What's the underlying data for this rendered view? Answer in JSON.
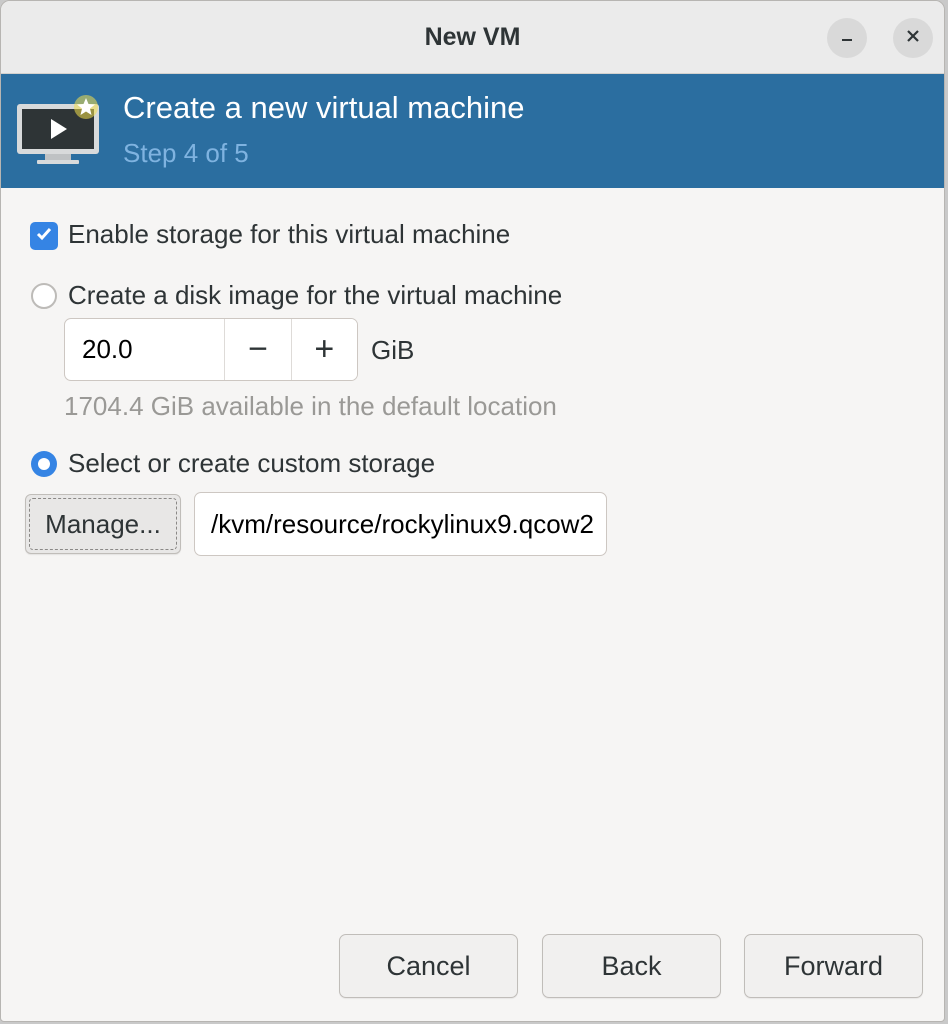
{
  "window": {
    "title": "New VM",
    "minimize_icon": "minimize-icon",
    "close_icon": "close-icon"
  },
  "banner": {
    "icon": "virtual-machine-icon",
    "heading": "Create a new virtual machine",
    "step": "Step 4 of 5",
    "background_color": "#2b6ea0"
  },
  "storage": {
    "enable_label": "Enable storage for this virtual machine",
    "enable_checked": true,
    "create_disk_label": "Create a disk image for the virtual machine",
    "create_disk_selected": false,
    "disk_size_value": "20.0",
    "decrement_label": "−",
    "increment_label": "+",
    "disk_size_unit": "GiB",
    "available_hint": "1704.4 GiB available in the default location",
    "custom_storage_label": "Select or create custom storage",
    "custom_storage_selected": true,
    "manage_label": "Manage...",
    "custom_path_value": "/kvm/resource/rockylinux9.qcow2"
  },
  "footer": {
    "cancel_label": "Cancel",
    "back_label": "Back",
    "forward_label": "Forward"
  },
  "colors": {
    "accent": "#3584e4"
  }
}
